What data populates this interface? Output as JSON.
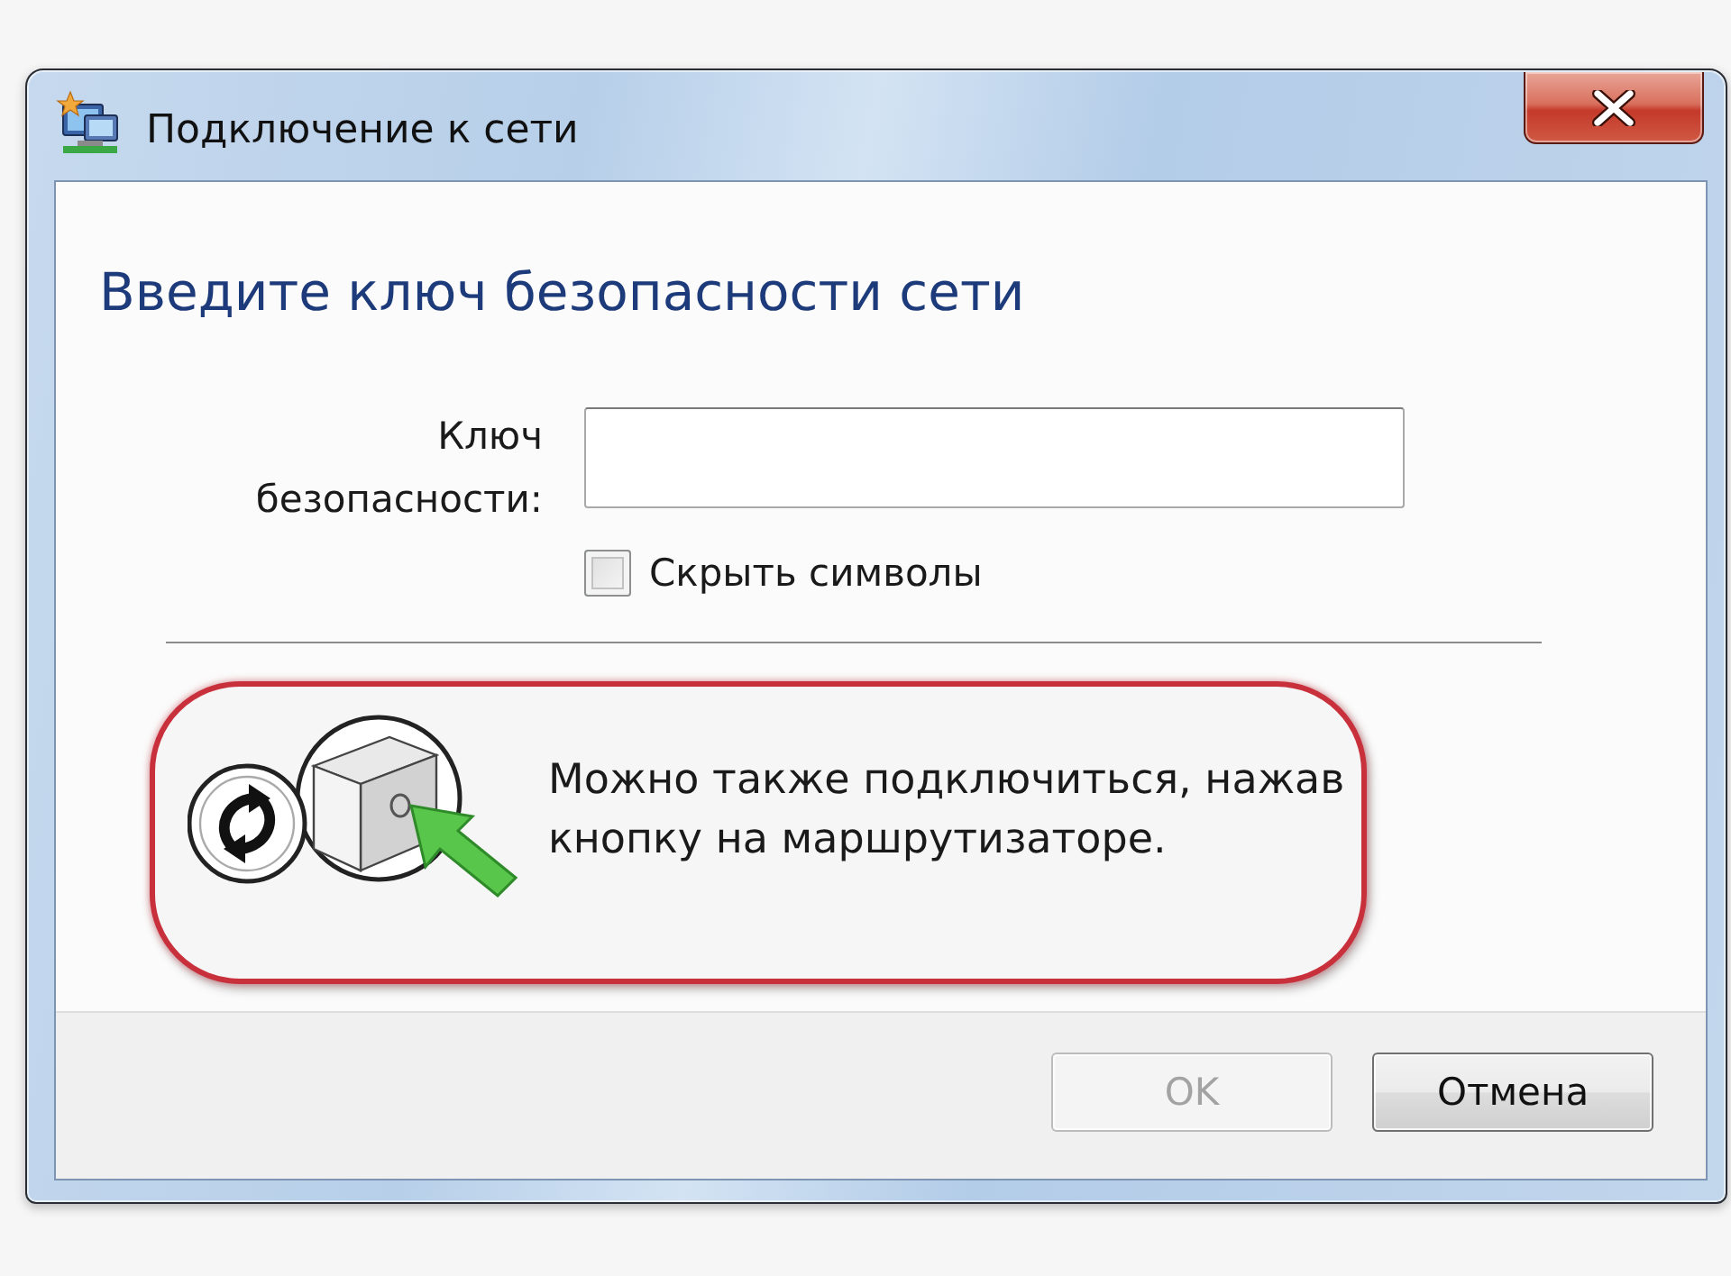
{
  "window": {
    "title": "Подключение к сети"
  },
  "heading": "Введите ключ безопасности сети",
  "key_field": {
    "label": "Ключ безопасности:"
  },
  "hide_characters": {
    "label": "Скрыть символы",
    "checked": false
  },
  "router_hint": "Можно также подключиться, нажав кнопку на маршрутизаторе.",
  "buttons": [
    {
      "label": "OK",
      "disabled": true
    },
    {
      "label": "Отмена",
      "disabled": false
    }
  ]
}
